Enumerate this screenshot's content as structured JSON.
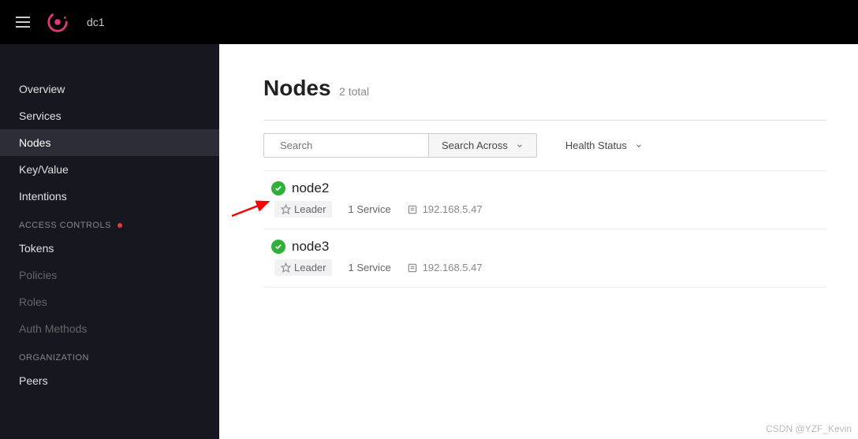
{
  "header": {
    "dc_label": "dc1"
  },
  "sidebar": {
    "items": [
      {
        "label": "Overview"
      },
      {
        "label": "Services"
      },
      {
        "label": "Nodes"
      },
      {
        "label": "Key/Value"
      },
      {
        "label": "Intentions"
      }
    ],
    "access_header": "ACCESS CONTROLS",
    "access_items": [
      {
        "label": "Tokens"
      },
      {
        "label": "Policies"
      },
      {
        "label": "Roles"
      },
      {
        "label": "Auth Methods"
      }
    ],
    "org_header": "ORGANIZATION",
    "org_items": [
      {
        "label": "Peers"
      }
    ]
  },
  "page": {
    "title": "Nodes",
    "subtitle": "2 total",
    "search_placeholder": "Search",
    "search_across_label": "Search Across",
    "health_status_label": "Health Status"
  },
  "nodes": [
    {
      "name": "node2",
      "leader": "Leader",
      "services": "1 Service",
      "ip": "192.168.5.47"
    },
    {
      "name": "node3",
      "leader": "Leader",
      "services": "1 Service",
      "ip": "192.168.5.47"
    }
  ],
  "watermark": "CSDN @YZF_Kevin"
}
